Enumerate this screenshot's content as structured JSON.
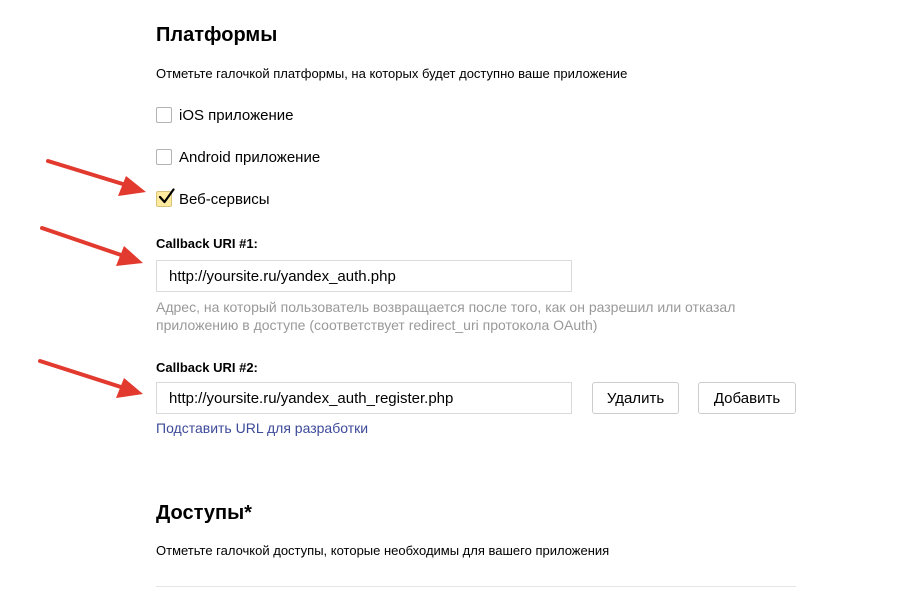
{
  "platforms": {
    "title": "Платформы",
    "description": "Отметьте галочкой платформы, на которых будет доступно ваше приложение",
    "options": [
      {
        "label": "iOS приложение",
        "checked": false
      },
      {
        "label": "Android приложение",
        "checked": false
      },
      {
        "label": "Веб-сервисы",
        "checked": true
      }
    ]
  },
  "callback1": {
    "label": "Callback URI #1:",
    "value": "http://yoursite.ru/yandex_auth.php",
    "hint": "Адрес, на который пользователь возвращается после того, как он разрешил или отказал приложению в доступе (соответствует redirect_uri протокола OAuth)"
  },
  "callback2": {
    "label": "Callback URI #2:",
    "value": "http://yoursite.ru/yandex_auth_register.php",
    "delete_label": "Удалить",
    "add_label": "Добавить",
    "dev_url_link": "Подставить URL для разработки"
  },
  "access": {
    "title": "Доступы*",
    "description": "Отметьте галочкой доступы, которые необходимы для вашего приложения"
  },
  "colors": {
    "arrow": "#e23a2e",
    "checked_bg": "#ffeba0",
    "link": "#3d4a99",
    "hint": "#999999"
  }
}
